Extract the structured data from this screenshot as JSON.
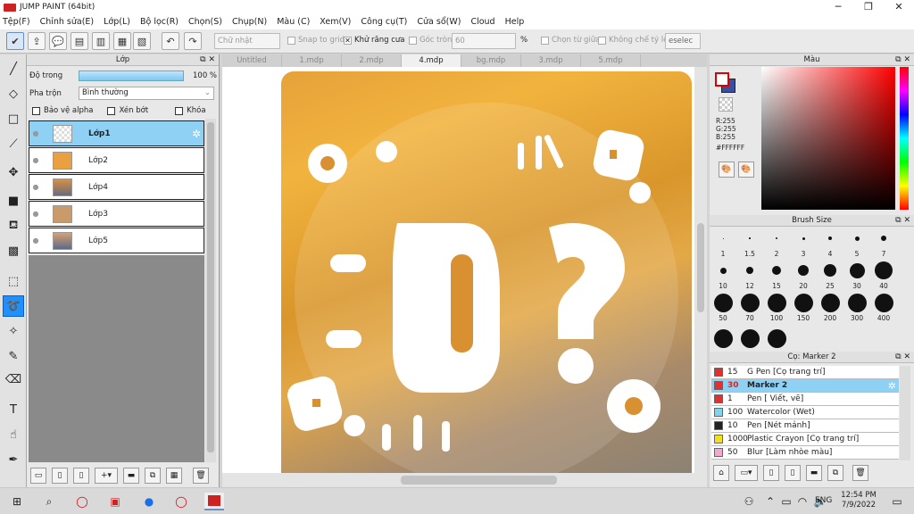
{
  "window": {
    "title": "JUMP PAINT (64bit)",
    "min": "─",
    "max": "❐",
    "close": "✕"
  },
  "menu": [
    "Tệp(F)",
    "Chỉnh sửa(E)",
    "Lớp(L)",
    "Bộ lọc(R)",
    "Chọn(S)",
    "Chụp(N)",
    "Màu (C)",
    "Xem(V)",
    "Công cụ(T)",
    "Cửa sổ(W)",
    "Cloud",
    "Help"
  ],
  "toolbar": {
    "shape_select": "Chữ nhật",
    "snap": "Snap to grid",
    "antialias": "Khử răng cưa",
    "corner": "Góc tròn",
    "corner_value": "60",
    "percent": "%",
    "from_center": "Chọn từ giữa",
    "ratio": "Không chế tỷ lệ",
    "deselect": "eselec"
  },
  "layer_panel": {
    "title": "Lớp",
    "opacity_label": "Độ trong",
    "opacity_value": "100 %",
    "opacity": 1.0,
    "blend_label": "Pha trộn",
    "blend_value": "Bình thường",
    "protect_alpha": "Bảo vệ alpha",
    "clip": "Xén bớt",
    "lock": "Khóa",
    "layers": [
      {
        "name": "Lớp1",
        "selected": true
      },
      {
        "name": "Lớp2"
      },
      {
        "name": "Lớp4"
      },
      {
        "name": "Lớp3"
      },
      {
        "name": "Lớp5"
      }
    ]
  },
  "tabs": [
    {
      "label": "Untitled"
    },
    {
      "label": "1.mdp"
    },
    {
      "label": "2.mdp"
    },
    {
      "label": "4.mdp",
      "active": true
    },
    {
      "label": "bg.mdp"
    },
    {
      "label": "3.mdp"
    },
    {
      "label": "5.mdp"
    }
  ],
  "canvas": {
    "question_mark": "?"
  },
  "color_panel": {
    "title": "Màu",
    "r": "R:255",
    "g": "G:255",
    "b": "B:255",
    "hex": "#FFFFFF",
    "fg": "#FFFFFF",
    "bg": "#3A4FA0"
  },
  "brush_panel": {
    "title": "Brush Size",
    "sizes": [
      "1",
      "1.5",
      "2",
      "3",
      "4",
      "5",
      "7",
      "10",
      "12",
      "15",
      "20",
      "25",
      "30",
      "40",
      "50",
      "70",
      "100",
      "150",
      "200",
      "300",
      "400"
    ]
  },
  "material_panel": {
    "title": "Cọ: Marker 2",
    "items": [
      {
        "size": "15",
        "name": "G Pen [Cọ trang trí]",
        "color": "#e03030"
      },
      {
        "size": "30",
        "name": "Marker 2",
        "color": "#e03030",
        "selected": true
      },
      {
        "size": "1",
        "name": "Pen [ Viết, vẽ]",
        "color": "#e03030"
      },
      {
        "size": "100",
        "name": "Watercolor (Wet)",
        "color": "#7fd4ee"
      },
      {
        "size": "10",
        "name": "Pen [Nét mảnh]",
        "color": "#222222"
      },
      {
        "size": "1000",
        "name": "Plastic Crayon [Cọ trang trí]",
        "color": "#f0e020"
      },
      {
        "size": "50",
        "name": "Blur [Làm nhòe màu]",
        "color": "#f2a9d0"
      }
    ]
  },
  "taskbar": {
    "lang": "ENG",
    "time": "12:54 PM",
    "date": "7/9/2022"
  }
}
